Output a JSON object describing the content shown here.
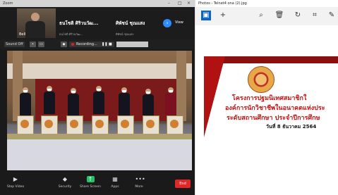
{
  "zoom": {
    "title": "Zoom",
    "gallery": {
      "video_tile_name": "Bell",
      "tiles": [
        {
          "name": "ธนโชติ ศิริวนวัฒ...",
          "sub": "ธนโชติ ศิริวนวัฒ..."
        },
        {
          "name": "ศิพัชน์ ชุณแสง",
          "sub": "ศิพัชน์ ชุณแสง"
        }
      ],
      "view_label": "View"
    },
    "second_toolbar": {
      "sound_label": "Sound Off",
      "recording_label": "Recording..."
    },
    "bottom_bar": [
      {
        "label": "Stop Video",
        "icon": "video-camera-icon"
      },
      {
        "label": "Security",
        "icon": "shield-icon"
      },
      {
        "label": "Share Screen",
        "icon": "share-screen-icon"
      },
      {
        "label": "Apps",
        "icon": "apps-icon"
      },
      {
        "label": "More",
        "icon": "more-icon"
      }
    ],
    "end_label": "End"
  },
  "photos": {
    "title": "Photos - Telnet4 ona (2).jpg",
    "slide": {
      "line1": "โครงการปฐมนิเทศสมาชิกใ",
      "line2": "องค์การนักวิชาชีพในอนาคตแห่งประ",
      "line3": "ระดับสถานศึกษา ประจำปีการศึกษ",
      "line4": "วันที่ 8 ธันวาคม 2564"
    }
  },
  "colors": {
    "zoom_bg": "#1a1a1a",
    "accent_blue": "#2d8cff",
    "share_green": "#25c26a",
    "end_red": "#e02828",
    "slide_red": "#c01414"
  }
}
